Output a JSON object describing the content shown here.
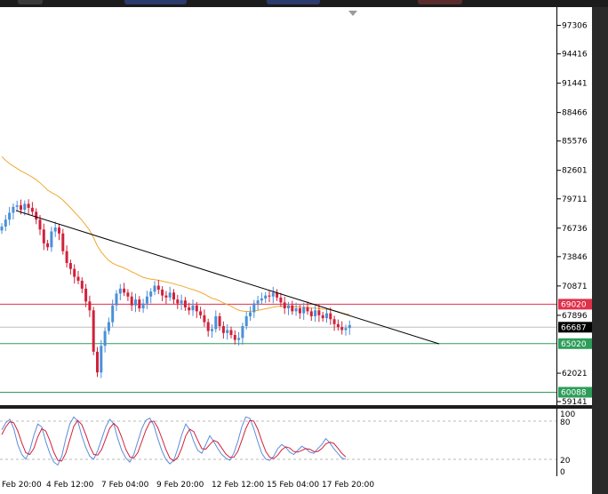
{
  "price_axis": {
    "min": 59141,
    "max": 98800,
    "ticks": [
      "97306",
      "94416",
      "91441",
      "88466",
      "85576",
      "82601",
      "79711",
      "76736",
      "73846",
      "70871",
      "67896",
      "62021",
      "59141"
    ]
  },
  "levels": [
    {
      "value": 69020,
      "label": "69020",
      "color": "#e0314b"
    },
    {
      "value": 66687,
      "label": "66687",
      "color": "#000000"
    },
    {
      "value": 65020,
      "label": "65020",
      "color": "#2e9d5a"
    },
    {
      "value": 60088,
      "label": "60088",
      "color": "#2e9d5a"
    }
  ],
  "osc_axis": {
    "ticks": [
      "100",
      "80",
      "20",
      "0"
    ]
  },
  "time_axis": {
    "labels": [
      "Feb 20:00",
      "4 Feb 12:00",
      "7 Feb 04:00",
      "9 Feb 20:00",
      "12 Feb 12:00",
      "15 Feb 04:00",
      "17 Feb 20:00"
    ]
  },
  "colors": {
    "bull": "#4a90d9",
    "bear": "#d1213a",
    "ma": "#f0a830",
    "trend": "#000000",
    "stoch_k": "#5b8dd9",
    "stoch_d": "#d1213a"
  },
  "chart_data": {
    "type": "candlestick",
    "closes": [
      76900,
      77600,
      78300,
      78900,
      79050,
      78600,
      79200,
      78800,
      78400,
      77600,
      76600,
      75200,
      74800,
      76400,
      76800,
      76200,
      74400,
      73200,
      72600,
      71800,
      71400,
      70600,
      69300,
      68400,
      64200,
      62100,
      64800,
      66300,
      67200,
      68900,
      70100,
      70600,
      70200,
      69800,
      68900,
      69500,
      68600,
      69100,
      69800,
      70300,
      70900,
      70500,
      69900,
      69700,
      70200,
      69500,
      69100,
      69400,
      68700,
      68400,
      68900,
      68300,
      67900,
      67200,
      66300,
      66500,
      67800,
      66800,
      66100,
      66400,
      65900,
      65400,
      65600,
      66800,
      67800,
      68200,
      69100,
      69400,
      69600,
      69900,
      69800,
      70200,
      69700,
      69200,
      68600,
      68900,
      68300,
      68600,
      68100,
      68700,
      68300,
      67800,
      68400,
      67900,
      67600,
      68100,
      67500,
      67000,
      66700,
      66400,
      66600,
      66900
    ],
    "stoch_k": [
      70,
      82,
      88,
      72,
      45,
      28,
      20,
      35,
      60,
      80,
      75,
      50,
      30,
      15,
      10,
      25,
      55,
      80,
      92,
      85,
      60,
      40,
      25,
      20,
      35,
      55,
      75,
      88,
      80,
      55,
      35,
      22,
      15,
      28,
      50,
      72,
      86,
      90,
      78,
      55,
      35,
      20,
      12,
      18,
      38,
      62,
      80,
      70,
      50,
      35,
      30,
      45,
      60,
      50,
      38,
      28,
      22,
      18,
      30,
      50,
      75,
      92,
      90,
      72,
      50,
      30,
      20,
      18,
      25,
      38,
      45,
      40,
      32,
      28,
      35,
      42,
      38,
      32,
      30,
      38,
      45,
      55,
      48,
      38,
      30,
      22,
      20
    ],
    "stoch_d": [
      62,
      75,
      84,
      82,
      68,
      48,
      31,
      28,
      38,
      58,
      72,
      68,
      52,
      32,
      18,
      17,
      30,
      53,
      76,
      86,
      79,
      62,
      42,
      28,
      27,
      37,
      55,
      73,
      81,
      74,
      57,
      37,
      24,
      22,
      31,
      50,
      69,
      83,
      85,
      74,
      56,
      37,
      22,
      17,
      23,
      39,
      60,
      71,
      67,
      52,
      38,
      37,
      45,
      52,
      49,
      39,
      29,
      23,
      23,
      33,
      52,
      72,
      86,
      85,
      71,
      51,
      33,
      23,
      21,
      27,
      36,
      41,
      39,
      33,
      32,
      35,
      38,
      37,
      33,
      33,
      38,
      46,
      49,
      47,
      39,
      30,
      24
    ]
  }
}
